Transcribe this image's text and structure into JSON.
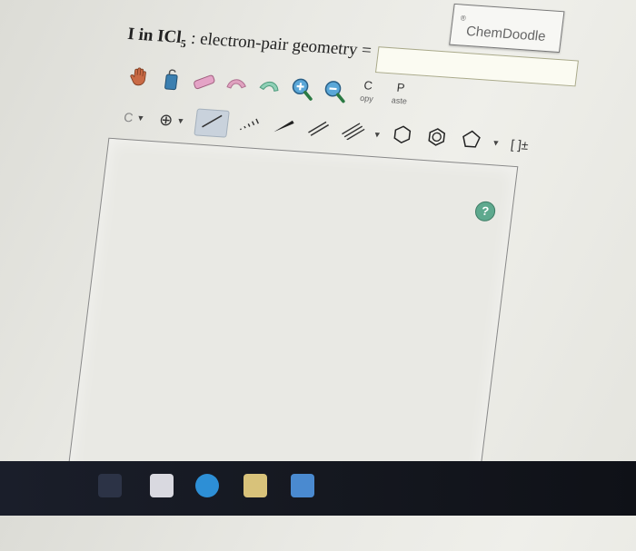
{
  "brand": {
    "name": "ChemDoodle",
    "mark": "®"
  },
  "question": {
    "prefix": "I in ICl",
    "subscript": "5",
    "suffix": " : electron-pair geometry ="
  },
  "answer_input": {
    "value": ""
  },
  "toolbar": {
    "copy": {
      "big": "C",
      "small": "opy"
    },
    "paste": {
      "big": "P",
      "small": "aste"
    },
    "element_selector": "C",
    "bracket_label": "[ ]±"
  },
  "help": {
    "label": "?"
  },
  "colors": {
    "accent": "#5ea98e",
    "selected_tool": "#c9d2dc",
    "taskbar": "#151820"
  }
}
